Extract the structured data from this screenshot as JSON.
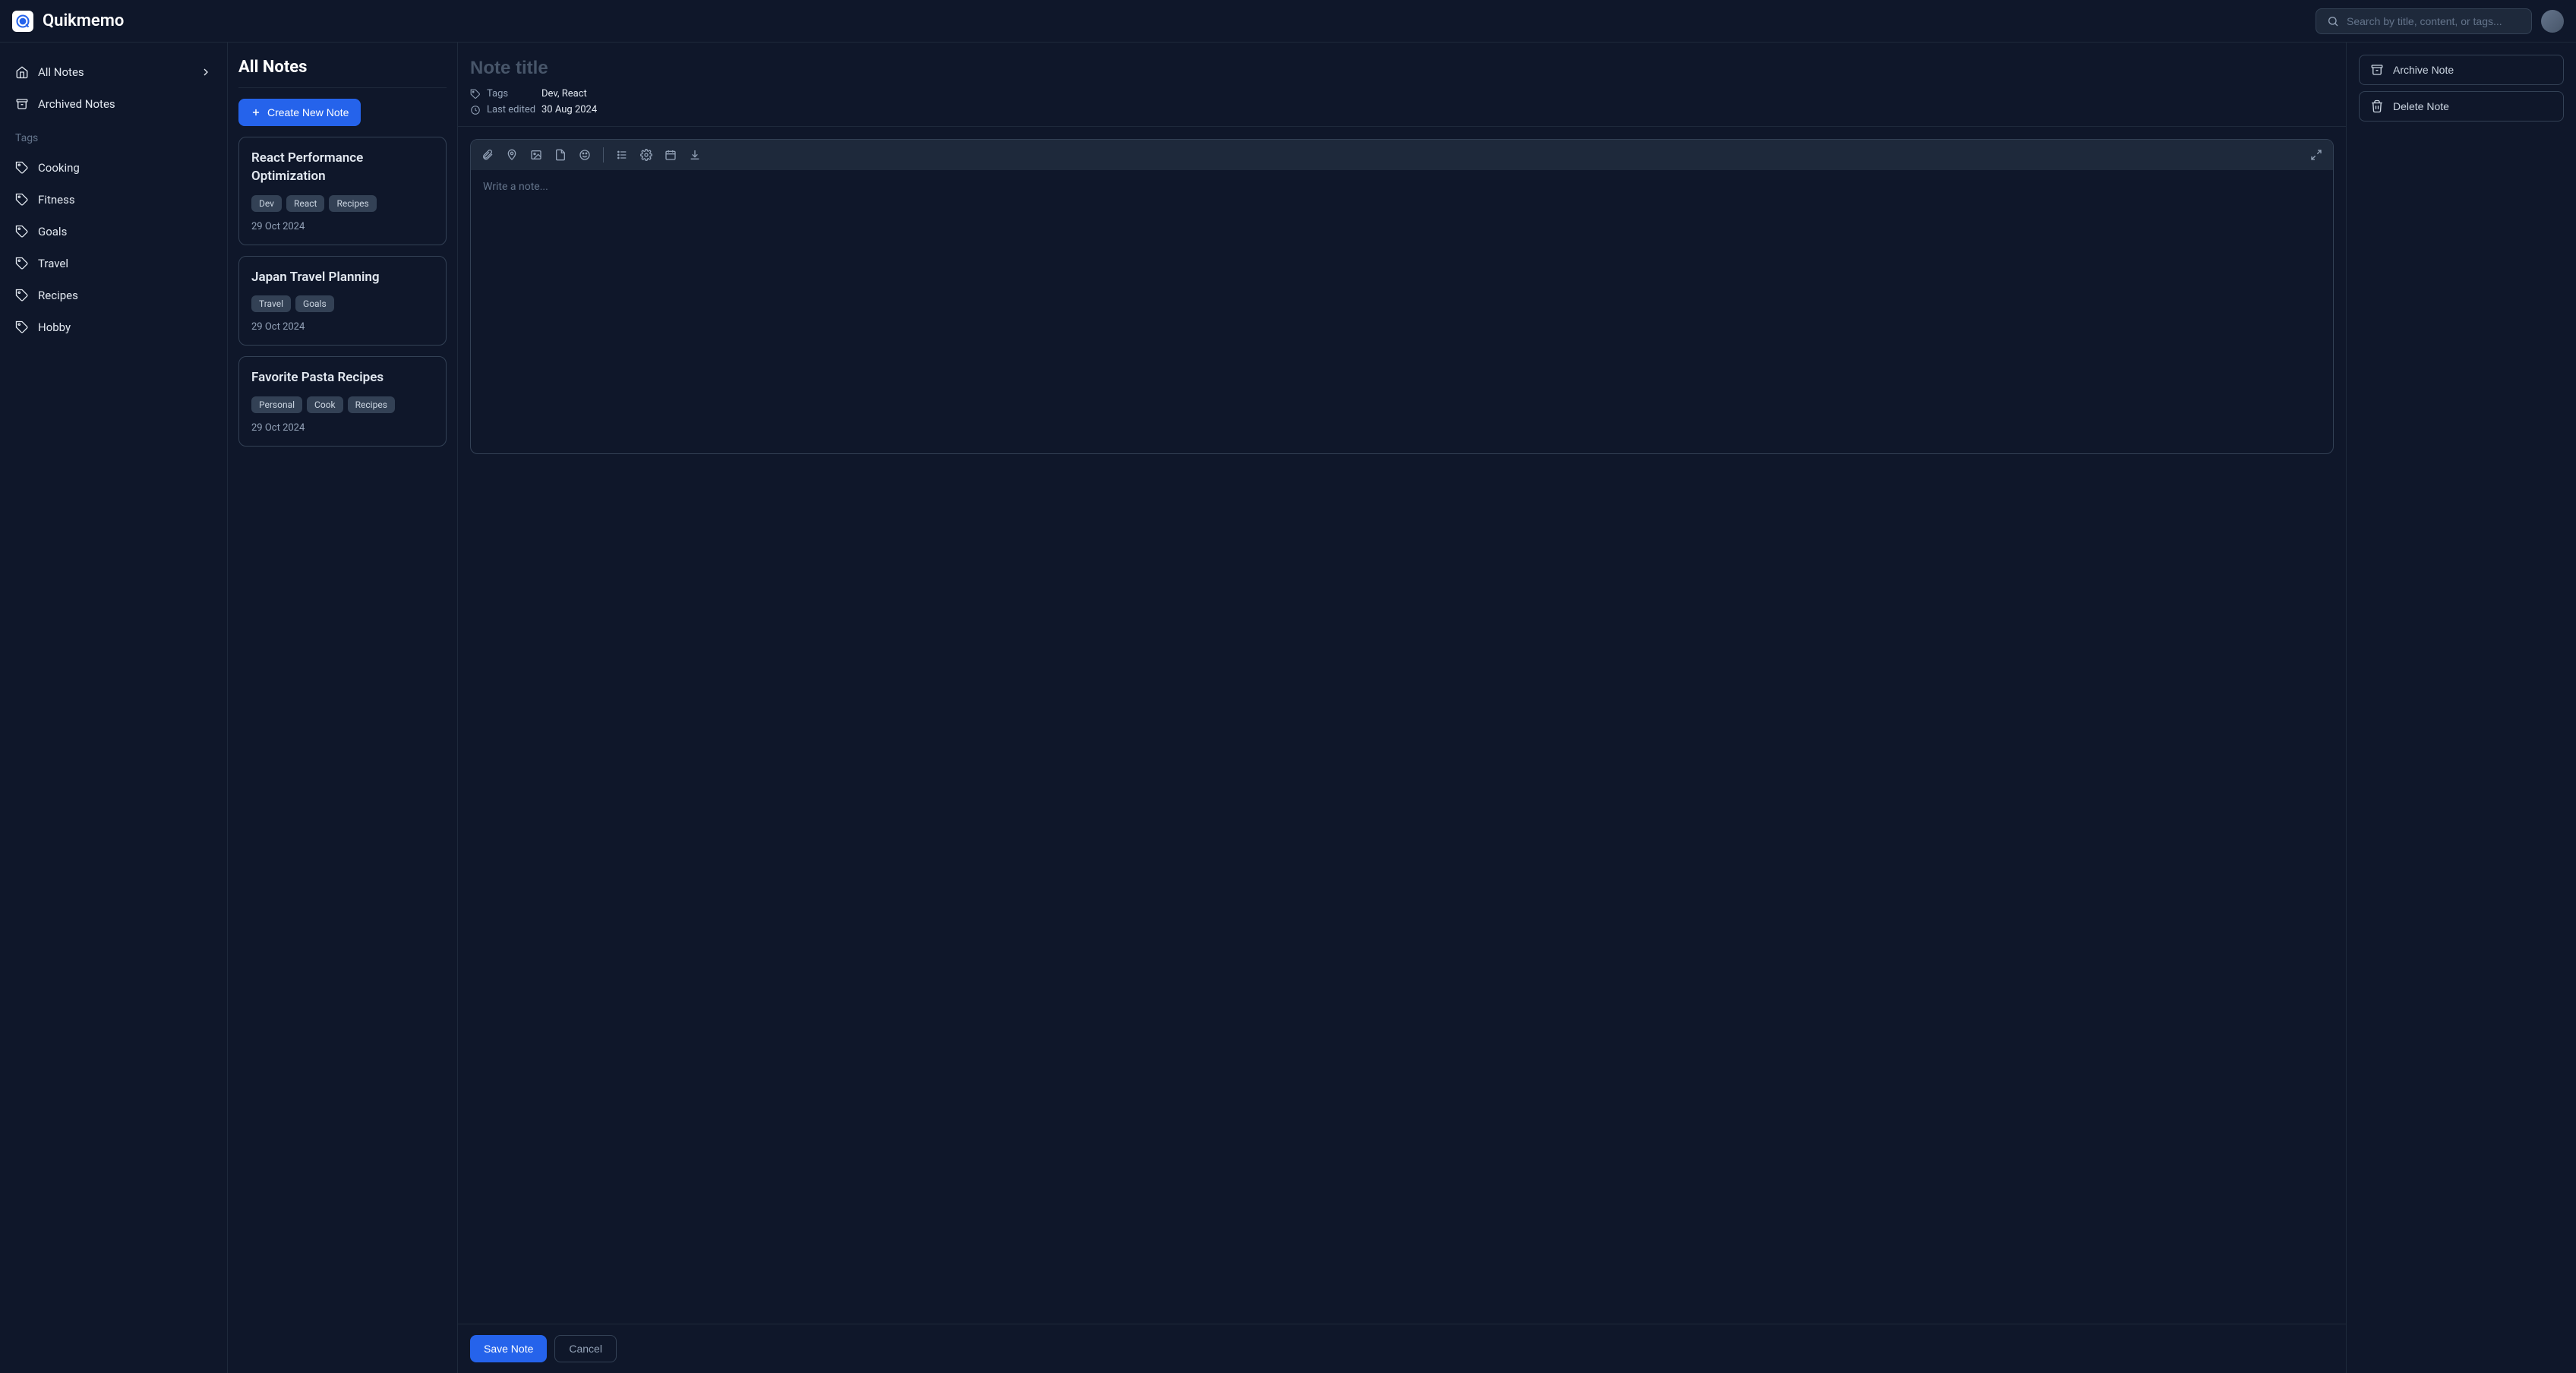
{
  "app": {
    "name": "Quikmemo"
  },
  "search": {
    "placeholder": "Search by title, content, or tags..."
  },
  "sidebar": {
    "all_notes_label": "All Notes",
    "archived_label": "Archived Notes",
    "tags_section_label": "Tags",
    "tags": [
      {
        "label": "Cooking"
      },
      {
        "label": "Fitness"
      },
      {
        "label": "Goals"
      },
      {
        "label": "Travel"
      },
      {
        "label": "Recipes"
      },
      {
        "label": "Hobby"
      }
    ]
  },
  "notes_column": {
    "heading": "All Notes",
    "create_button": "Create New Note",
    "notes": [
      {
        "title": "React Performance Optimization",
        "tags": [
          "Dev",
          "React",
          "Recipes"
        ],
        "date": "29 Oct 2024"
      },
      {
        "title": "Japan Travel Planning",
        "tags": [
          "Travel",
          "Goals"
        ],
        "date": "29 Oct 2024"
      },
      {
        "title": "Favorite Pasta Recipes",
        "tags": [
          "Personal",
          "Cook",
          "Recipes"
        ],
        "date": "29 Oct 2024"
      }
    ]
  },
  "editor": {
    "title_placeholder": "Note title",
    "tags_label": "Tags",
    "tags_value": "Dev, React",
    "edited_label": "Last edited",
    "edited_value": "30 Aug 2024",
    "body_placeholder": "Write a note...",
    "save_label": "Save Note",
    "cancel_label": "Cancel"
  },
  "actions": {
    "archive_label": "Archive Note",
    "delete_label": "Delete Note"
  }
}
